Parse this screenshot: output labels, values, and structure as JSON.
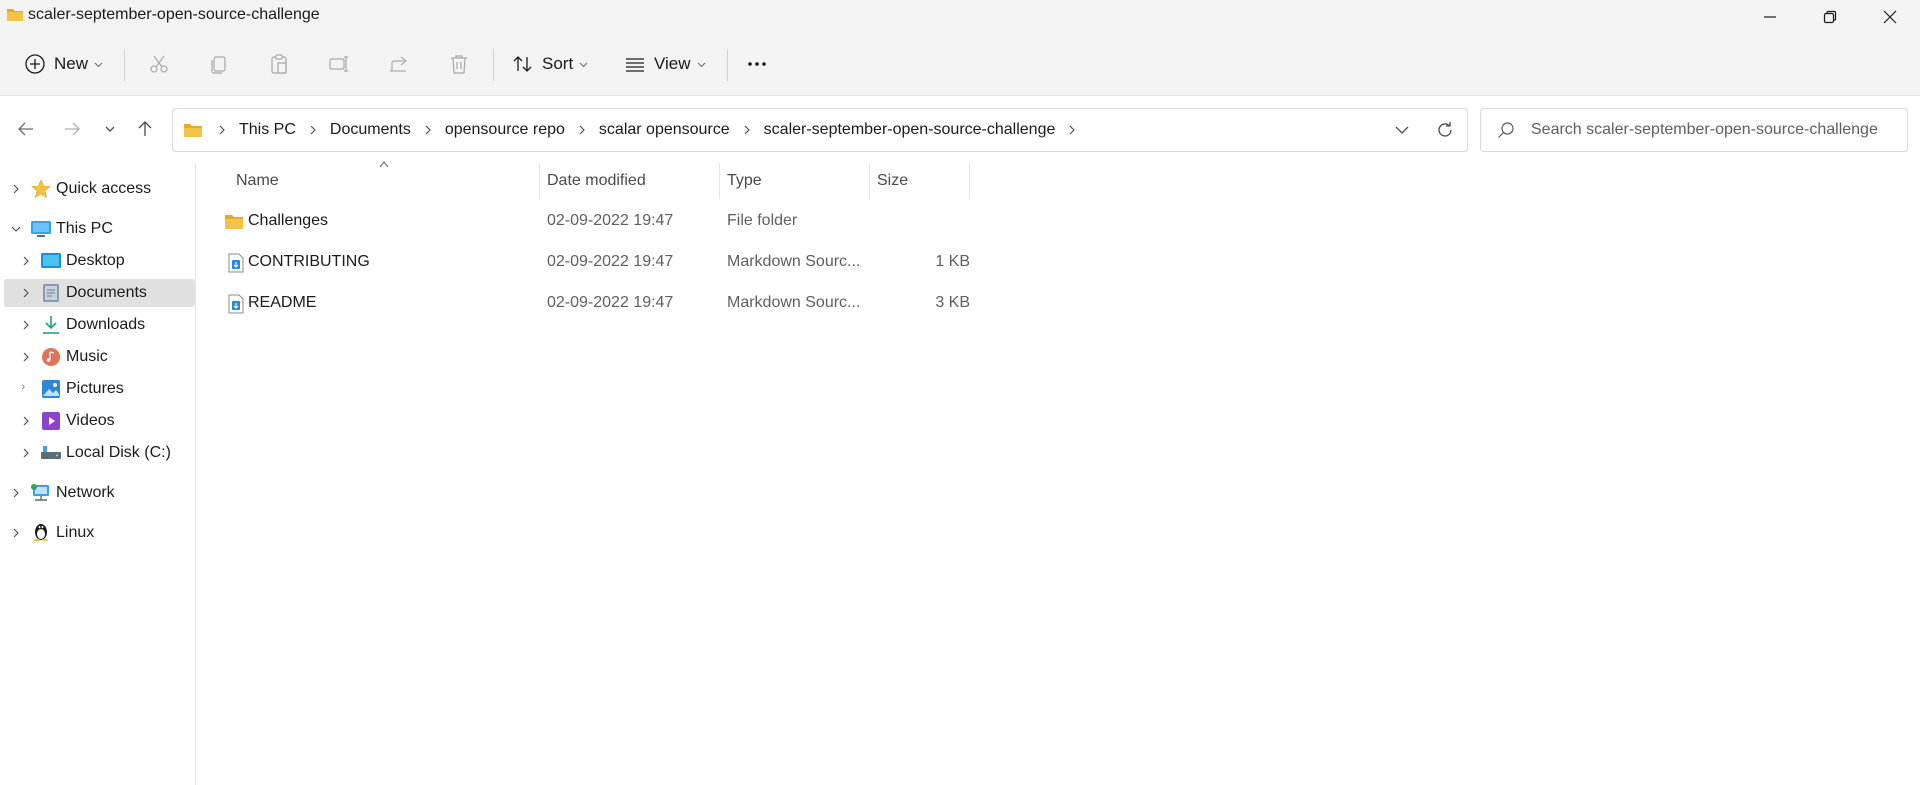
{
  "window": {
    "title": "scaler-september-open-source-challenge"
  },
  "commandbar": {
    "new_label": "New",
    "sort_label": "Sort",
    "view_label": "View"
  },
  "address": {
    "breadcrumbs": [
      "This PC",
      "Documents",
      "opensource repo",
      "scalar opensource",
      "scaler-september-open-source-challenge"
    ]
  },
  "search": {
    "placeholder": "Search scaler-september-open-source-challenge"
  },
  "sidebar": {
    "items": [
      {
        "label": "Quick access"
      },
      {
        "label": "This PC"
      },
      {
        "label": "Desktop"
      },
      {
        "label": "Documents"
      },
      {
        "label": "Downloads"
      },
      {
        "label": "Music"
      },
      {
        "label": "Pictures"
      },
      {
        "label": "Videos"
      },
      {
        "label": "Local Disk (C:)"
      },
      {
        "label": "Network"
      },
      {
        "label": "Linux"
      }
    ]
  },
  "filelist": {
    "columns": {
      "name": "Name",
      "date": "Date modified",
      "type": "Type",
      "size": "Size"
    },
    "rows": [
      {
        "name": "Challenges",
        "date": "02-09-2022 19:47",
        "type": "File folder",
        "size": ""
      },
      {
        "name": "CONTRIBUTING",
        "date": "02-09-2022 19:47",
        "type": "Markdown Sourc...",
        "size": "1 KB"
      },
      {
        "name": "README",
        "date": "02-09-2022 19:47",
        "type": "Markdown Sourc...",
        "size": "3 KB"
      }
    ]
  },
  "colors": {
    "folder": "#f4c244",
    "accent": "#0067c0",
    "selection": "#e0e0e0"
  }
}
